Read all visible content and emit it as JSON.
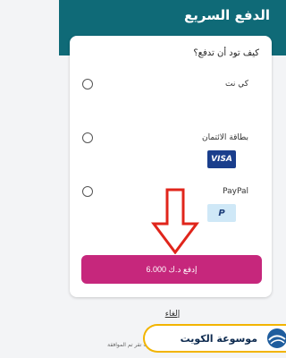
{
  "header": {
    "title": "الدفع السريع",
    "bg_color": "#0f6a77"
  },
  "card": {
    "question": "كيف تود أن تدفع؟",
    "options": [
      {
        "label": "كي نت",
        "selected": false
      },
      {
        "label": "بطاقة الائتمان",
        "selected": false,
        "badge": "VISA"
      },
      {
        "label": "PayPal",
        "selected": false,
        "badge": "P"
      }
    ]
  },
  "pay_button": {
    "label": "إدفع د.ك 6.000",
    "color": "#c6277c"
  },
  "cancel_link": "إلغاء",
  "terms_text": "بالدفع، أنت تقر تم الموافقة",
  "watermark": {
    "text": "موسوعة الكويت",
    "accent_color": "#f2b400"
  }
}
